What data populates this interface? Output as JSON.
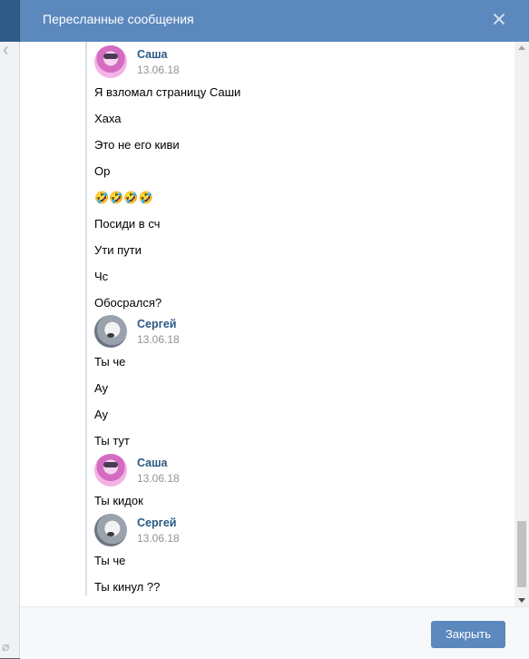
{
  "dialog": {
    "title": "Пересланные сообщения",
    "close_label": "Закрыть"
  },
  "blocks": [
    {
      "author": "Саша",
      "date": "13.06.18",
      "avatar": "sasha",
      "messages": [
        "Я взломал страницу Саши",
        "Хаха",
        "Это не его киви",
        "Ор",
        "🤣🤣🤣🤣",
        "Посиди в сч",
        "Ути пути",
        "Чс",
        "Обосрался?"
      ]
    },
    {
      "author": "Сергей",
      "date": "13.06.18",
      "avatar": "sergey",
      "messages": [
        "Ты че",
        "Ау",
        "Ау",
        "Ты тут"
      ]
    },
    {
      "author": "Саша",
      "date": "13.06.18",
      "avatar": "sasha",
      "messages": [
        "Ты кидок"
      ]
    },
    {
      "author": "Сергей",
      "date": "13.06.18",
      "avatar": "sergey",
      "messages": [
        "Ты че",
        "Ты кинул ??"
      ]
    }
  ]
}
